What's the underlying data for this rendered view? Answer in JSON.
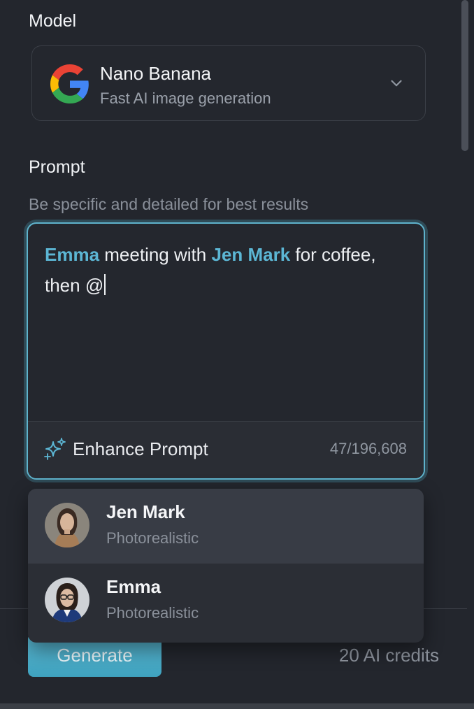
{
  "model": {
    "label": "Model",
    "name": "Nano Banana",
    "description": "Fast AI image generation",
    "logo_icon": "google-g-icon"
  },
  "prompt": {
    "label": "Prompt",
    "hint": "Be specific and detailed for best results",
    "segments": [
      {
        "text": "Emma",
        "type": "mention"
      },
      {
        "text": " meeting with ",
        "type": "text"
      },
      {
        "text": "Jen Mark",
        "type": "mention"
      },
      {
        "text": " for coffee, then @",
        "type": "text"
      }
    ],
    "enhance_label": "Enhance Prompt",
    "char_count": "47/196,608"
  },
  "mention_suggestions": [
    {
      "name": "Jen Mark",
      "style": "Photorealistic",
      "active": true
    },
    {
      "name": "Emma",
      "style": "Photorealistic",
      "active": false
    }
  ],
  "footer": {
    "generate_label": "Generate",
    "credits": "20 AI credits"
  },
  "colors": {
    "accent": "#5cb6d4",
    "background": "#23262d"
  }
}
